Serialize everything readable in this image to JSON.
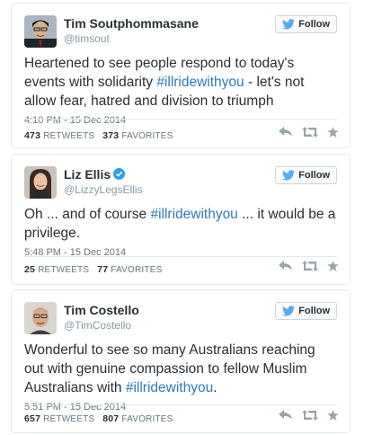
{
  "colors": {
    "link": "#2b7bb9",
    "verified": "#2e9fe6",
    "follow_bird": "#55acee",
    "muted": "#8899a6"
  },
  "follow_label": "Follow",
  "tweets": [
    {
      "name": "Tim Soutphommasane",
      "handle": "@timsout",
      "verified": false,
      "text_before": "Heartened to see people respond to today's events with solidarity ",
      "hashtag": "#illridewithyou",
      "text_after": " - let's not allow fear, hatred and division to triumph",
      "timestamp": "4:10 PM - 15 Dec 2014",
      "retweets": "473",
      "retweets_label": "RETWEETS",
      "favorites": "373",
      "favorites_label": "FAVORITES"
    },
    {
      "name": "Liz Ellis",
      "handle": "@LizzyLegsEllis",
      "verified": true,
      "text_before": "Oh ... and of course ",
      "hashtag": "#illridewithyou",
      "text_after": " ... it would be a privilege.",
      "timestamp": "5:48 PM - 15 Dec 2014",
      "retweets": "25",
      "retweets_label": "RETWEETS",
      "favorites": "77",
      "favorites_label": "FAVORITES"
    },
    {
      "name": "Tim Costello",
      "handle": "@TimCostello",
      "verified": false,
      "text_before": "Wonderful to see so many Australians reaching out with genuine compassion to fellow Muslim Australians with ",
      "hashtag": "#illridewithyou",
      "text_after": ".",
      "timestamp": "5:51 PM - 15 Dec 2014",
      "retweets": "657",
      "retweets_label": "RETWEETS",
      "favorites": "807",
      "favorites_label": "FAVORITES"
    }
  ]
}
